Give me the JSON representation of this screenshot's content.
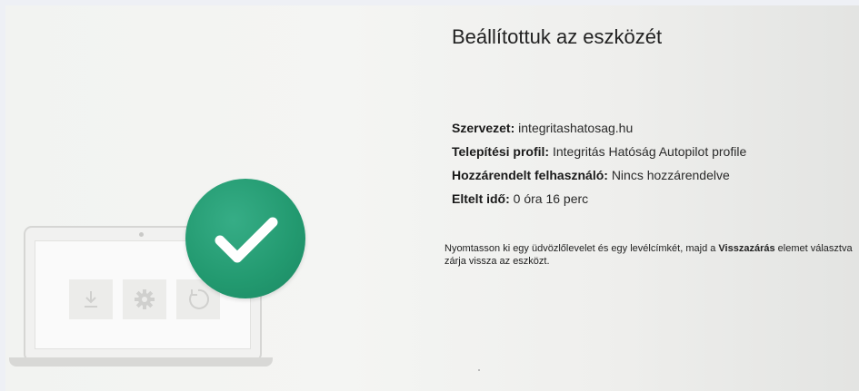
{
  "heading": "Beállítottuk az eszközét",
  "details": {
    "organization_label": "Szervezet:",
    "organization_value": "integritashatosag.hu",
    "profile_label": "Telepítési profil:",
    "profile_value": "Integritás Hatóság Autopilot profile",
    "user_label": "Hozzárendelt felhasználó:",
    "user_value": "Nincs hozzárendelve",
    "elapsed_label": "Eltelt idő:",
    "elapsed_value": "0 óra 16 perc"
  },
  "instruction": {
    "text_before": "Nyomtasson ki egy üdvözlőlevelet és egy levélcímkét, majd a ",
    "bold_word": "Visszazárás",
    "text_after": " elemet választva zárja vissza az eszközt."
  },
  "colors": {
    "accent_green": "#22996f",
    "background": "#f2f3f1"
  },
  "icons": [
    "download-icon",
    "gear-icon",
    "refresh-icon",
    "checkmark-icon"
  ]
}
